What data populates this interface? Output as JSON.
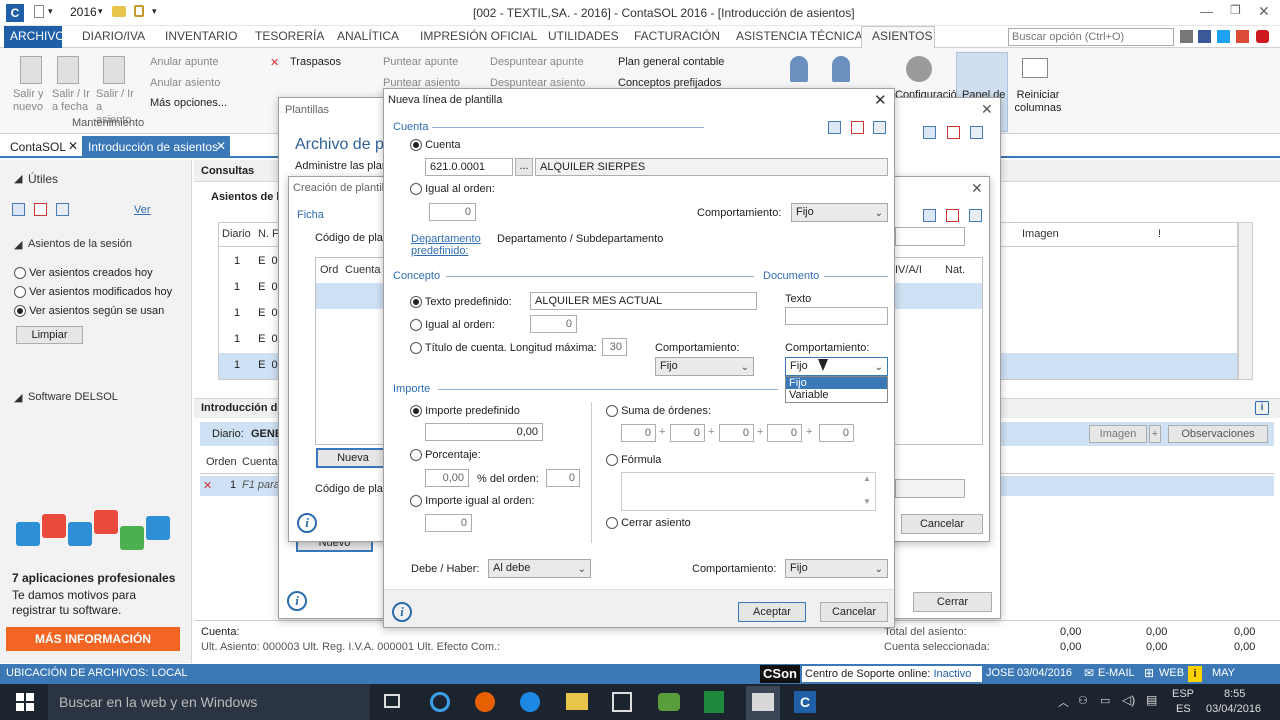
{
  "titlebar": {
    "year": "2016",
    "title": "[002 - TEXTIL,SA. - 2016] - ContaSOL 2016 - [Introducción de asientos]"
  },
  "menu": [
    "ARCHIVO",
    "DIARIO/IVA",
    "INVENTARIO",
    "TESORERÍA",
    "ANALÍTICA",
    "IMPRESIÓN OFICIAL",
    "UTILIDADES",
    "FACTURACIÓN",
    "ASISTENCIA TÉCNICA",
    "ASIENTOS"
  ],
  "search": {
    "placeholder": "Buscar opción (Ctrl+O)"
  },
  "ribbon": {
    "salir_nuevo": "Salir y nuevo",
    "salir_fecha": "Salir / Ir a fecha",
    "salir_asiento": "Salir / Ir a asiento",
    "group_mantenimiento": "Mantenimiento",
    "anular_apunte": "Anular apunte",
    "anular_asiento": "Anular asiento",
    "mas_opciones": "Más opciones...",
    "traspasos": "Traspasos",
    "puntear_apunte": "Puntear apunte",
    "puntear_asiento": "Puntear asiento",
    "despuntear_apunte": "Despuntear apunte",
    "despuntear_asiento": "Despuntear asiento",
    "plan_general": "Plan general contable",
    "conceptos": "Conceptos prefijados",
    "configuracion": "Configuración",
    "panel_de": "Panel de",
    "reiniciar": "Reiniciar columnas"
  },
  "doctabs": [
    "ContaSOL",
    "Introducción de asientos"
  ],
  "left": {
    "utiles": "Útiles",
    "ver": "Ver",
    "asientos_sesion": "Asientos de la sesión",
    "opt1": "Ver asientos creados hoy",
    "opt2": "Ver asientos modificados hoy",
    "opt3": "Ver asientos según se usan",
    "limpiar": "Limpiar",
    "software": "Software DELSOL",
    "promo_title": "7 aplicaciones profesionales",
    "promo_text": "Te damos motivos para registrar tu software.",
    "promo_btn": "MÁS INFORMACIÓN"
  },
  "main": {
    "consultas": "Consultas",
    "asientos_de_la": "Asientos de la",
    "col_diario": "Diario",
    "col_n": "N.",
    "col_f": "F",
    "col_imagen": "Imagen",
    "col_excl": "!",
    "rows": [
      [
        "1",
        "E",
        "0"
      ],
      [
        "1",
        "E",
        "0"
      ],
      [
        "1",
        "E",
        "0"
      ],
      [
        "1",
        "E",
        "0"
      ],
      [
        "1",
        "E",
        "0"
      ]
    ],
    "intro": "Introducción de",
    "diario": "Diario:",
    "diario_val": "GENE",
    "btn_imagen": "Imagen",
    "btn_obs": "Observaciones",
    "col_orden": "Orden",
    "col_cuenta": "Cuenta",
    "row1_orden": "1",
    "row1_hint": "F1 para",
    "cuenta_lbl": "Cuenta:",
    "ult": "Ult. Asiento: 000003  Ult. Reg. I.V.A. 000001  Ult. Efecto Com.:",
    "total_asiento": "Total del asiento:",
    "cuenta_sel": "Cuenta seleccionada:",
    "zeros": [
      "0,00",
      "0,00",
      "0,00"
    ]
  },
  "plantillas": {
    "title": "Plantillas",
    "heading": "Archivo de pl",
    "sub": "Administre las plan",
    "cerrar": "Cerrar",
    "nuevo": "Nuevo"
  },
  "creacion": {
    "title": "Creación de plantil",
    "ficha": "Ficha",
    "codigo": "Código de pla",
    "codigo2": "Código de pla",
    "col_ord": "Ord",
    "col_cuenta": "Cuenta",
    "col_iva": "IV/A/I",
    "col_nat": "Nat.",
    "nueva": "Nueva",
    "cancelar": "Cancelar"
  },
  "dialog": {
    "title": "Nueva línea de plantilla",
    "cuenta_group": "Cuenta",
    "cuenta_radio": "Cuenta",
    "cuenta_code": "621.0.0001",
    "cuenta_name": "ALQUILER SIERPES",
    "igual_orden": "Igual al orden:",
    "igual_val": "0",
    "comportamiento": "Comportamiento:",
    "comp1": "Fijo",
    "depto_link": "Departamento predefinido:",
    "depto_val": "Departamento / Subdepartamento",
    "concepto_group": "Concepto",
    "documento_group": "Documento",
    "texto_pred": "Texto predefinido:",
    "texto_val": "ALQUILER MES ACTUAL",
    "igual_orden2": "Igual al orden:",
    "igual2_val": "0",
    "titulo_cuenta": "Título de cuenta. Longitud máxima:",
    "long_val": "30",
    "comp_concepto": "Comportamiento:",
    "comp2": "Fijo",
    "texto": "Texto",
    "comp_doc": "Comportamiento:",
    "comp3": "Fijo",
    "dd_options": [
      "Fijo",
      "Variable"
    ],
    "importe_group": "Importe",
    "importe_pred": "Importe predefinido",
    "importe_val": "0,00",
    "porcentaje": "Porcentaje:",
    "porc_val": "0,00",
    "del_orden": "% del orden:",
    "del_val": "0",
    "importe_igual": "Importe igual al orden:",
    "imp_igual_val": "0",
    "suma": "Suma de órdenes:",
    "suma_vals": [
      "0",
      "0",
      "0",
      "0",
      "0"
    ],
    "formula": "Fórmula",
    "cerrar_asiento": "Cerrar asiento",
    "debe_haber": "Debe / Haber:",
    "debe_val": "Al debe",
    "comp_bottom": "Comportamiento:",
    "comp4": "Fijo",
    "aceptar": "Aceptar",
    "cancelar": "Cancelar"
  },
  "status": {
    "ubicacion": "UBICACIÓN DE ARCHIVOS: LOCAL",
    "cson": "CSon",
    "soporte": "Centro de Soporte online:",
    "inactivo": "Inactivo",
    "user": "JOSE",
    "date": "03/04/2016",
    "email": "E-MAIL",
    "web": "WEB",
    "may": "MAY"
  },
  "taskbar": {
    "search": "Buscar en la web y en Windows",
    "lang": "ESP",
    "lang2": "ES",
    "time": "8:55",
    "date": "03/04/2016"
  }
}
